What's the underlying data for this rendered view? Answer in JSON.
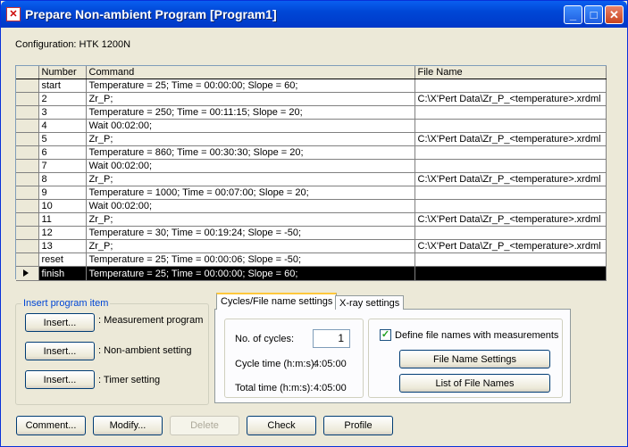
{
  "window": {
    "title": "Prepare Non-ambient Program [Program1]"
  },
  "configuration": "Configuration: HTK 1200N",
  "table": {
    "headers": [
      "Number",
      "Command",
      "File Name"
    ],
    "rows": [
      {
        "number": "start",
        "command": "Temperature = 25; Time = 00:00:00; Slope = 60;",
        "file": ""
      },
      {
        "number": "2",
        "command": "Zr_P;",
        "file": "C:\\X'Pert Data\\Zr_P_<temperature>.xrdml"
      },
      {
        "number": "3",
        "command": "Temperature = 250; Time = 00:11:15; Slope = 20;",
        "file": ""
      },
      {
        "number": "4",
        "command": "Wait 00:02:00;",
        "file": ""
      },
      {
        "number": "5",
        "command": "Zr_P;",
        "file": "C:\\X'Pert Data\\Zr_P_<temperature>.xrdml"
      },
      {
        "number": "6",
        "command": "Temperature = 860; Time = 00:30:30; Slope = 20;",
        "file": ""
      },
      {
        "number": "7",
        "command": "Wait 00:02:00;",
        "file": ""
      },
      {
        "number": "8",
        "command": "Zr_P;",
        "file": "C:\\X'Pert Data\\Zr_P_<temperature>.xrdml"
      },
      {
        "number": "9",
        "command": "Temperature = 1000; Time = 00:07:00; Slope = 20;",
        "file": ""
      },
      {
        "number": "10",
        "command": "Wait 00:02:00;",
        "file": ""
      },
      {
        "number": "11",
        "command": "Zr_P;",
        "file": "C:\\X'Pert Data\\Zr_P_<temperature>.xrdml"
      },
      {
        "number": "12",
        "command": "Temperature = 30; Time = 00:19:24; Slope = -50;",
        "file": ""
      },
      {
        "number": "13",
        "command": "Zr_P;",
        "file": "C:\\X'Pert Data\\Zr_P_<temperature>.xrdml"
      },
      {
        "number": "reset",
        "command": "Temperature = 25; Time = 00:00:06; Slope = -50;",
        "file": ""
      },
      {
        "number": "finish",
        "command": "Temperature = 25; Time = 00:00:00; Slope = 60;",
        "file": ""
      }
    ]
  },
  "insert_group": {
    "legend": "Insert program item",
    "items": [
      {
        "button": "Insert...",
        "label": ": Measurement program"
      },
      {
        "button": "Insert...",
        "label": ": Non-ambient setting"
      },
      {
        "button": "Insert...",
        "label": ": Timer setting"
      }
    ]
  },
  "tabs": [
    "Cycles/File name settings",
    "X-ray settings"
  ],
  "cycles": {
    "label": "No. of cycles:",
    "value": "1",
    "cycle_time_label": "Cycle time (h:m:s):",
    "cycle_time": "4:05:00",
    "total_time_label": "Total time (h:m:s):",
    "total_time": "4:05:00"
  },
  "file_names": {
    "checkbox_label": "Define file names with measurements",
    "checkbox_mark": "✓",
    "settings_button": "File Name Settings",
    "list_button": "List of File Names"
  },
  "bottom_buttons": {
    "comment": "Comment...",
    "modify": "Modify...",
    "delete": "Delete",
    "check": "Check",
    "profile": "Profile"
  },
  "title_buttons": {
    "minimize": "_",
    "maximize": "□",
    "close": "✕"
  }
}
